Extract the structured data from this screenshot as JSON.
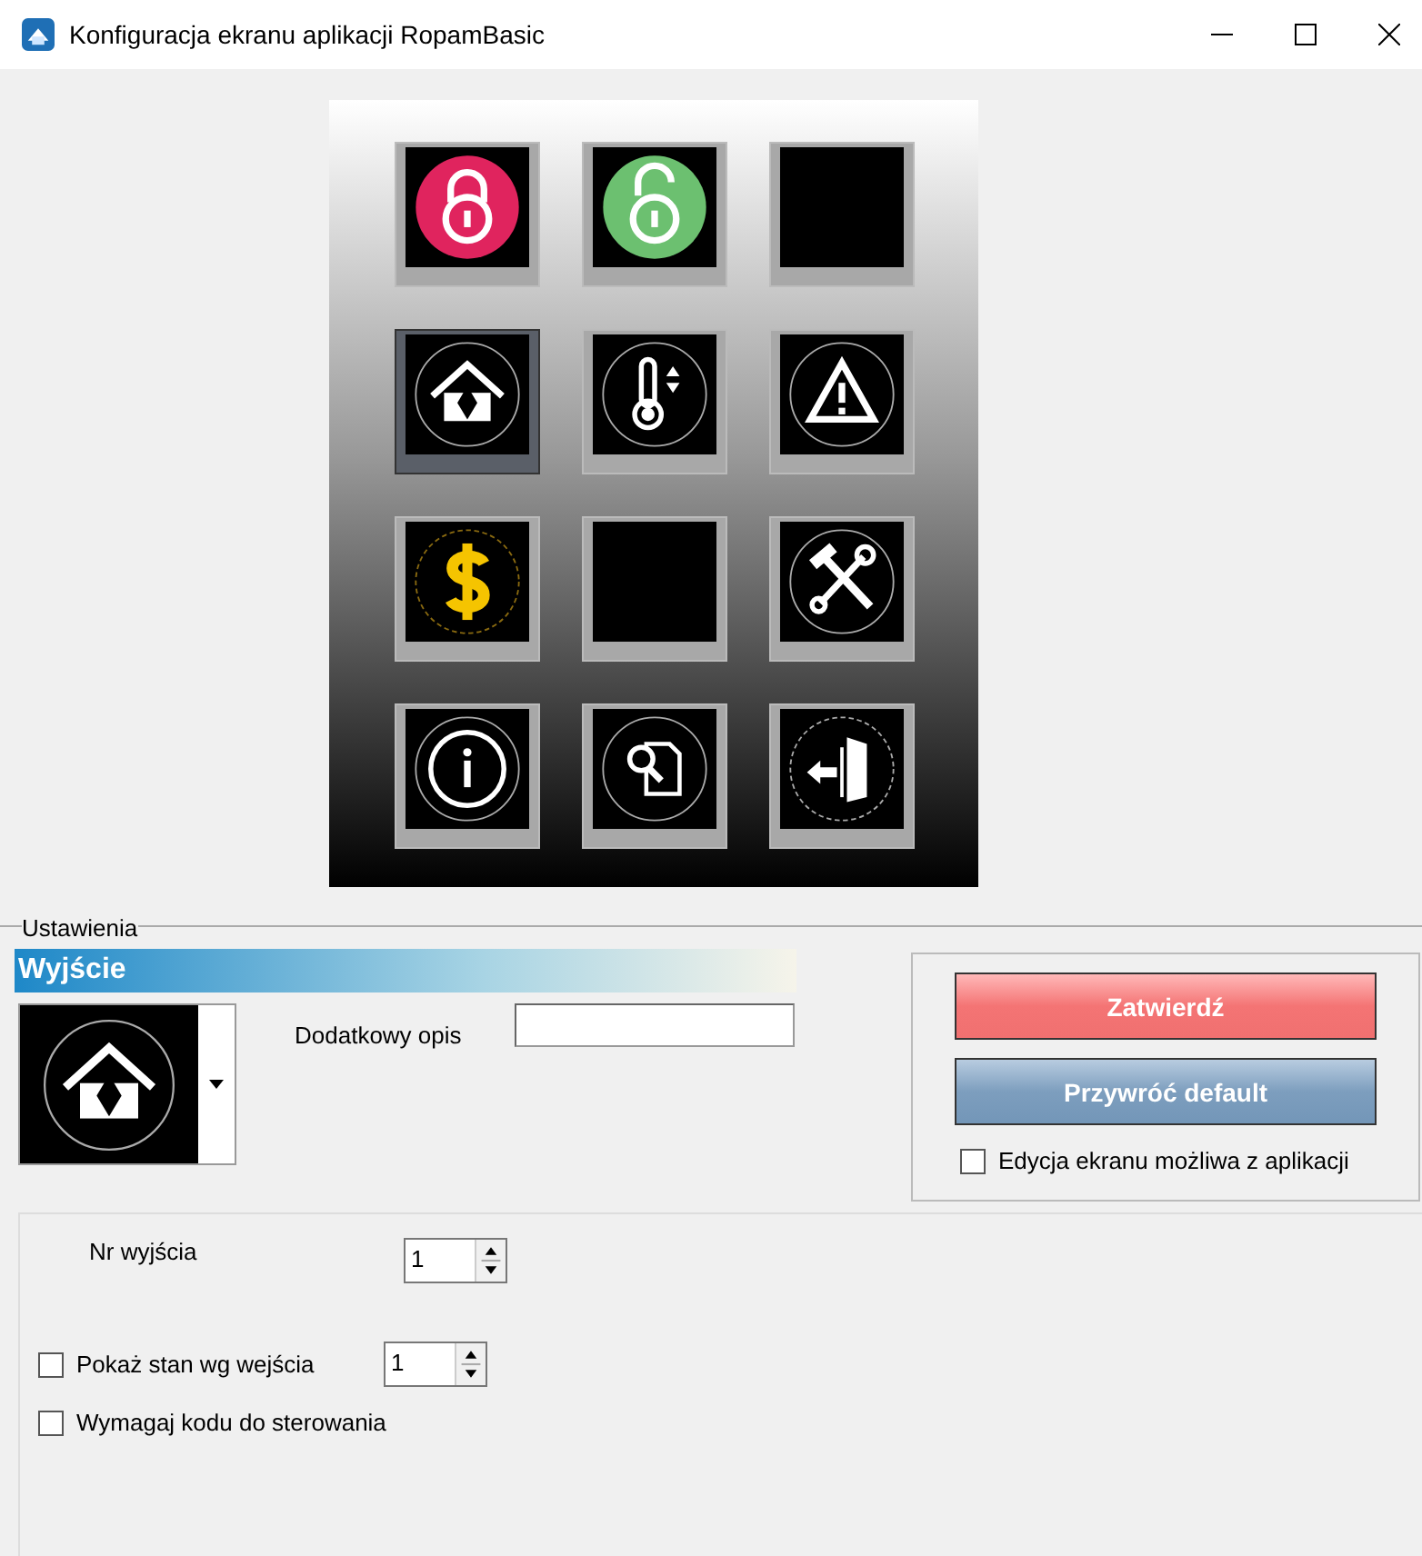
{
  "window": {
    "title": "Konfiguracja ekranu aplikacji RopamBasic"
  },
  "tiles": [
    {
      "kind": "lock-closed",
      "selected": false
    },
    {
      "kind": "lock-open",
      "selected": false
    },
    {
      "kind": "empty",
      "selected": false
    },
    {
      "kind": "house",
      "selected": true
    },
    {
      "kind": "thermometer",
      "selected": false
    },
    {
      "kind": "warning",
      "selected": false
    },
    {
      "kind": "dollar",
      "selected": false
    },
    {
      "kind": "empty",
      "selected": false
    },
    {
      "kind": "tools",
      "selected": false
    },
    {
      "kind": "info",
      "selected": false
    },
    {
      "kind": "search-doc",
      "selected": false
    },
    {
      "kind": "exit",
      "selected": false
    }
  ],
  "settings": {
    "group_label": "Ustawienia",
    "header": "Wyjście",
    "icon_picker": {
      "kind": "house"
    },
    "description_label": "Dodatkowy opis",
    "buttons": [
      {
        "label": "Zatwierdź",
        "kind": "confirm"
      },
      {
        "label": "Przywróć default",
        "kind": "reset"
      }
    ],
    "edit_checkbox": {
      "label": "Edycja ekranu możliwa z aplikacji",
      "checked": false
    },
    "output_number": {
      "label": "Nr wyjścia",
      "value": "1"
    },
    "show_state": {
      "label": "Pokaż stan wg wejścia",
      "checked": false,
      "value": "1"
    },
    "require_code": {
      "label": "Wymagaj kodu do sterowania",
      "checked": false
    }
  }
}
